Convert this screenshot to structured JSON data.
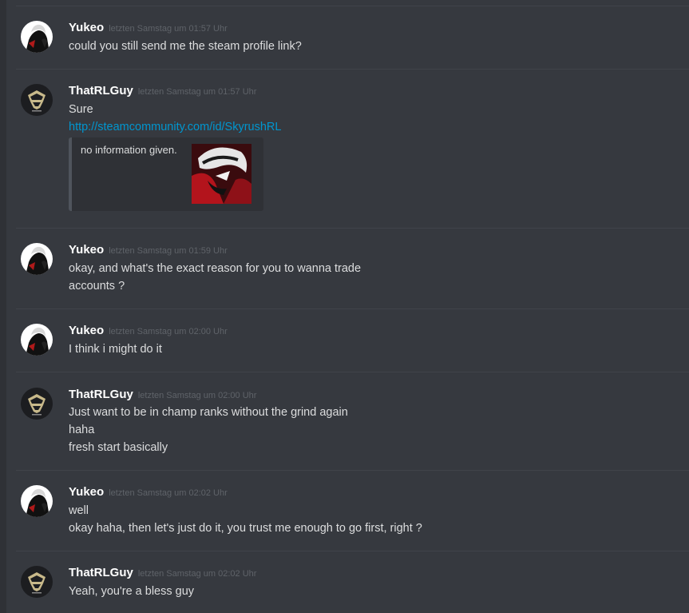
{
  "messages": [
    {
      "author": "Yukeo",
      "timestamp": "letzten Samstag um 01:57 Uhr",
      "avatar": "yukeo-avatar",
      "lines": [
        "could you still send me the steam profile link?"
      ]
    },
    {
      "author": "ThatRLGuy",
      "timestamp": "letzten Samstag um 01:57 Uhr",
      "avatar": "thatrlguy-avatar",
      "lines": [
        "Sure"
      ],
      "link": "http://steamcommunity.com/id/SkyrushRL",
      "embed": {
        "description": "no information given."
      }
    },
    {
      "author": "Yukeo",
      "timestamp": "letzten Samstag um 01:59 Uhr",
      "avatar": "yukeo-avatar",
      "lines": [
        "okay, and what's the exact reason for you to wanna trade",
        "accounts ?"
      ]
    },
    {
      "author": "Yukeo",
      "timestamp": "letzten Samstag um 02:00 Uhr",
      "avatar": "yukeo-avatar",
      "lines": [
        "I think i might do it"
      ]
    },
    {
      "author": "ThatRLGuy",
      "timestamp": "letzten Samstag um 02:00 Uhr",
      "avatar": "thatrlguy-avatar",
      "lines": [
        "Just want to be in champ ranks without the grind again",
        "haha",
        "fresh start basically"
      ]
    },
    {
      "author": "Yukeo",
      "timestamp": "letzten Samstag um 02:02 Uhr",
      "avatar": "yukeo-avatar",
      "lines": [
        "well",
        "okay haha, then let's just do it, you trust me enough to go first, right ?"
      ]
    },
    {
      "author": "ThatRLGuy",
      "timestamp": "letzten Samstag um 02:02 Uhr",
      "avatar": "thatrlguy-avatar",
      "lines": [
        "Yeah, you're a bless guy"
      ]
    }
  ],
  "colors": {
    "background": "#36393f",
    "username": "#ffffff",
    "timestamp": "#5f6369",
    "text": "#dcddde",
    "link": "#0096cf",
    "divider": "#40434a"
  }
}
